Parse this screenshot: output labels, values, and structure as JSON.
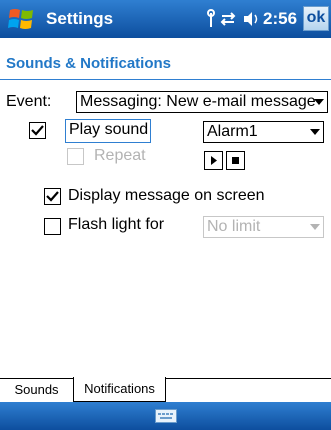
{
  "titlebar": {
    "title": "Settings",
    "time": "2:56",
    "ok_label": "ok",
    "icons": [
      "windows-flag-icon",
      "connectivity-icon",
      "data-connection-icon",
      "volume-icon"
    ]
  },
  "header": {
    "title": "Sounds & Notifications"
  },
  "event": {
    "label": "Event:",
    "value": "Messaging: New e-mail message"
  },
  "play_sound": {
    "label": "Play sound",
    "checked": true,
    "sound_value": "Alarm1"
  },
  "repeat": {
    "label": "Repeat",
    "checked": false,
    "disabled": true
  },
  "controls": {
    "play": "play-icon",
    "stop": "stop-icon"
  },
  "display_message": {
    "label": "Display message on screen",
    "checked": true
  },
  "flash_light": {
    "label": "Flash light for",
    "checked": false,
    "duration_value": "No limit",
    "duration_disabled": true
  },
  "tabs": [
    {
      "label": "Sounds",
      "selected": false
    },
    {
      "label": "Notifications",
      "selected": true
    }
  ],
  "softbar": {
    "icon": "keyboard-icon"
  },
  "colors": {
    "bar_blue": "#2f7fd1",
    "header_text": "#2278c7",
    "disabled_gray": "#b3b3b3"
  }
}
